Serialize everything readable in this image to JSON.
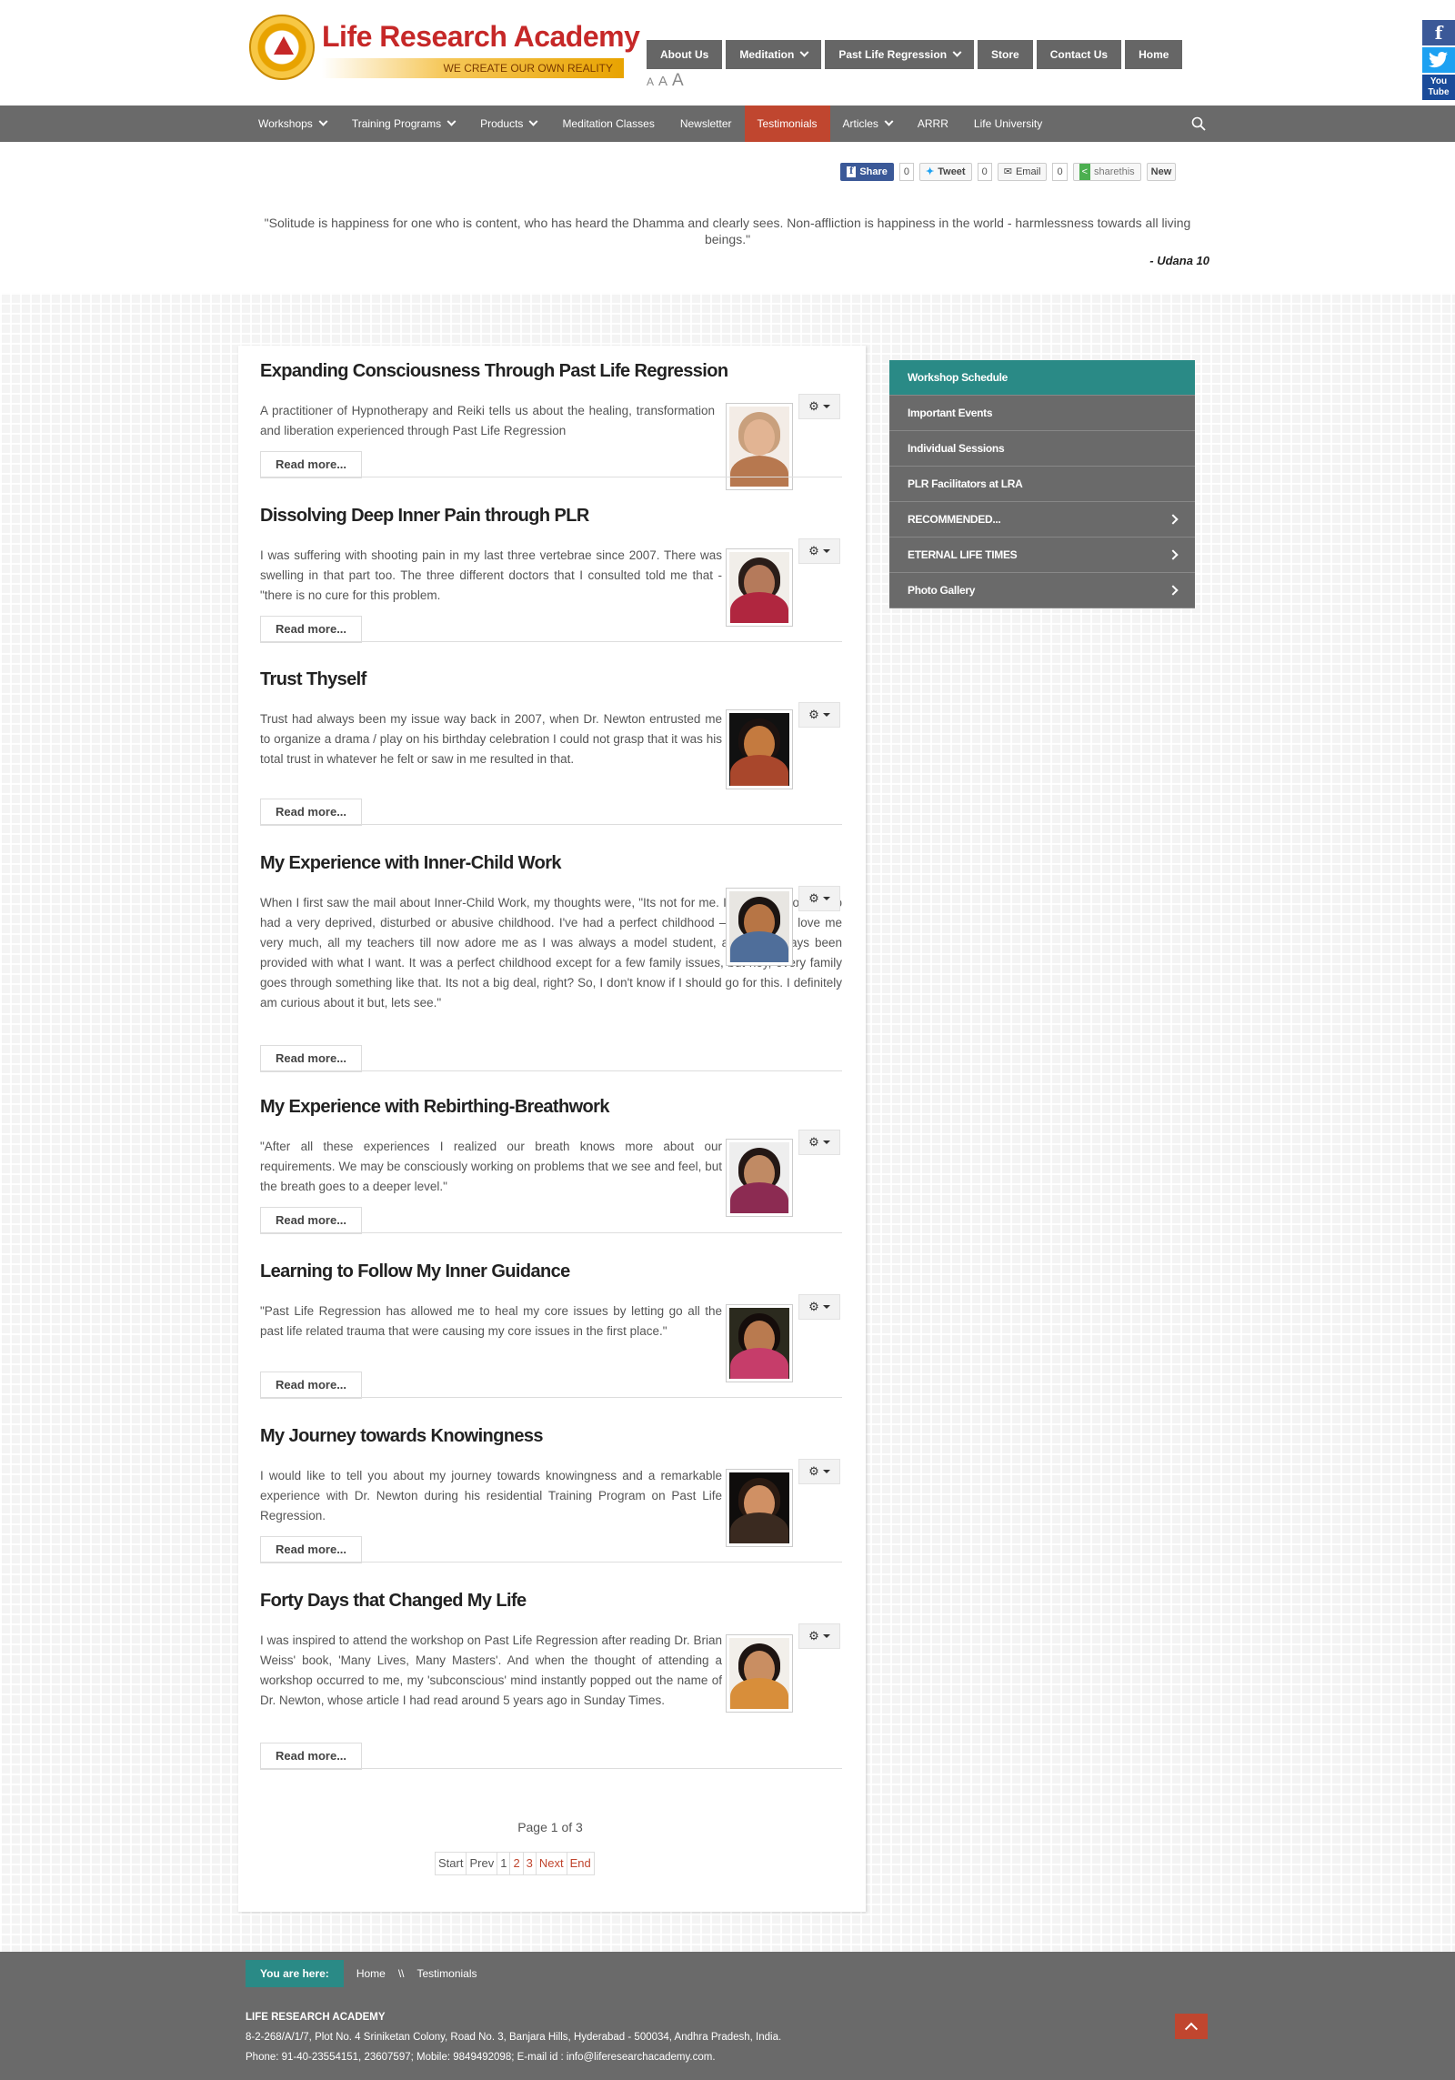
{
  "logo": {
    "title": "Life Research Academy",
    "tagline": "WE CREATE OUR OWN REALITY"
  },
  "topnav": [
    {
      "label": "About Us",
      "dropdown": false
    },
    {
      "label": "Meditation",
      "dropdown": true
    },
    {
      "label": "Past Life Regression",
      "dropdown": true
    },
    {
      "label": "Store",
      "dropdown": false
    },
    {
      "label": "Contact Us",
      "dropdown": false
    },
    {
      "label": "Home",
      "dropdown": false
    }
  ],
  "fontsize": [
    "A",
    "A",
    "A"
  ],
  "social": {
    "facebook": "f",
    "twitter": "t",
    "youtube_1": "You",
    "youtube_2": "Tube"
  },
  "mainnav": [
    {
      "label": "Workshops",
      "dropdown": true
    },
    {
      "label": "Training Programs",
      "dropdown": true
    },
    {
      "label": "Products",
      "dropdown": true
    },
    {
      "label": "Meditation Classes",
      "dropdown": false
    },
    {
      "label": "Newsletter",
      "dropdown": false
    },
    {
      "label": "Testimonials",
      "dropdown": false,
      "active": true
    },
    {
      "label": "Articles",
      "dropdown": true
    },
    {
      "label": "ARRR",
      "dropdown": false
    },
    {
      "label": "Life University",
      "dropdown": false
    }
  ],
  "share": {
    "facebook": "Share",
    "facebook_count": "0",
    "tweet": "Tweet",
    "tweet_count": "0",
    "email": "Email",
    "email_count": "0",
    "sharethis": "sharethis",
    "new": "New"
  },
  "quote": {
    "text": "\"Solitude is happiness for one who is content, who has heard the Dhamma and clearly sees. Non-affliction is happiness in the world - harmlessness towards all living beings.\"",
    "source": "- Udana 10"
  },
  "articles": [
    {
      "title": "Expanding Consciousness Through Past Life Regression",
      "body": "A practitioner of Hypnotherapy and Reiki tells us about the healing, transformation and liberation experienced through Past Life Regression",
      "read_more": "Read more..."
    },
    {
      "title": "Dissolving Deep Inner Pain through PLR",
      "body": "I was suffering with shooting pain in my last three vertebrae since 2007. There was swelling in that part too. The three different doctors that I consulted told me that - \"there is no cure for this problem.",
      "read_more": "Read more..."
    },
    {
      "title": "Trust Thyself",
      "body": "Trust had always been my issue way back in 2007, when Dr. Newton entrusted me to organize a drama / play on his birthday celebration I could not grasp that it was his total trust in whatever he felt or saw in me resulted in that.",
      "read_more": "Read more..."
    },
    {
      "title": "My Experience with Inner-Child Work",
      "body": "When I first saw the mail about Inner-Child Work, my thoughts were, \"Its not for me. Its for the people who had a very deprived, disturbed or abusive childhood. I've had a perfect childhood – My parents love me very much, all my teachers till now adore me as I was always a model student, and I've always been provided with what I want. It was a perfect childhood except for a few family issues, but hey, every family goes through something like that. Its not a big deal, right? So, I don't know if I should go for this. I definitely am curious about it but, lets see.\"",
      "read_more": "Read more..."
    },
    {
      "title": "My Experience with Rebirthing-Breathwork",
      "body": "\"After all these experiences I realized our breath knows more about our requirements. We may be consciously working on problems that we see and feel, but the breath goes to a deeper level.\"",
      "read_more": "Read more..."
    },
    {
      "title": "Learning to Follow My Inner Guidance",
      "body": "\"Past Life Regression has allowed me to heal my core issues by letting go all the past life related trauma that were causing my core issues in the first place.\"",
      "read_more": "Read more..."
    },
    {
      "title": "My Journey towards Knowingness",
      "body": "I would like to tell you about my journey towards knowingness and a remarkable experience with Dr. Newton during his residential Training Program on Past Life Regression.",
      "read_more": "Read more..."
    },
    {
      "title": "Forty Days that Changed My Life",
      "body": "I was inspired to attend the workshop on Past Life Regression after reading Dr. Brian Weiss' book, 'Many Lives, Many Masters'. And when the thought of attending a workshop occurred to me, my 'subconscious' mind instantly popped out the name of Dr. Newton, whose article I had read around 5 years ago in Sunday Times.",
      "read_more": "Read more..."
    }
  ],
  "pagination": {
    "info": "Page 1 of 3",
    "start": "Start",
    "prev": "Prev",
    "p1": "1",
    "p2": "2",
    "p3": "3",
    "next": "Next",
    "end": "End"
  },
  "sidebar": [
    {
      "label": "Workshop Schedule",
      "active": true,
      "arrow": false
    },
    {
      "label": "Important Events",
      "active": false,
      "arrow": false
    },
    {
      "label": "Individual Sessions",
      "active": false,
      "arrow": false
    },
    {
      "label": "PLR Facilitators at LRA",
      "active": false,
      "arrow": false
    },
    {
      "label": "RECOMMENDED...",
      "active": false,
      "arrow": true
    },
    {
      "label": "ETERNAL LIFE TIMES",
      "active": false,
      "arrow": true
    },
    {
      "label": "Photo Gallery",
      "active": false,
      "arrow": true
    }
  ],
  "breadcrumb": {
    "label": "You are here:",
    "home": "Home",
    "separator": "\\\\",
    "current": "Testimonials"
  },
  "footer": {
    "name": "LIFE RESEARCH ACADEMY",
    "address": "8-2-268/A/1/7, Plot No. 4 Sriniketan Colony, Road No. 3, Banjara Hills, Hyderabad - 500034, Andhra Pradesh, India.",
    "contact": "Phone: 91-40-23554151, 23607597; Mobile: 9849492098; E-mail id : info@liferesearchacademy.com."
  },
  "colors": {
    "nav_gray": "#6a6a6a",
    "accent_red": "#c0462f",
    "accent_teal": "#2a8a86",
    "logo_red": "#c62828"
  }
}
